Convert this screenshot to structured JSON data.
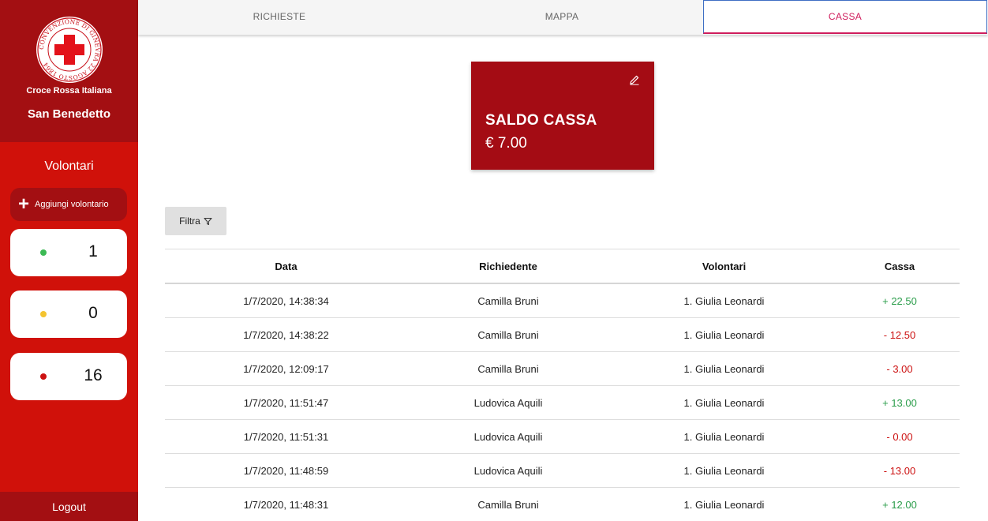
{
  "sidebar": {
    "org_name": "Croce Rossa Italiana",
    "branch_name": "San Benedetto",
    "logo_text": "CONVENZIONE DI GINEVRA 22 AGOSTO 1864",
    "volunteers_title": "Volontari",
    "add_volunteer_label": "Aggiungi volontario",
    "stats": [
      {
        "status": "available",
        "color": "#3cba54",
        "count": "1"
      },
      {
        "status": "busy",
        "color": "#f4c430",
        "count": "0"
      },
      {
        "status": "unavailable",
        "color": "#cc1111",
        "count": "16"
      }
    ],
    "logout_label": "Logout"
  },
  "tabs": [
    {
      "label": "RICHIESTE",
      "active": false
    },
    {
      "label": "MAPPA",
      "active": false
    },
    {
      "label": "CASSA",
      "active": true
    }
  ],
  "balance": {
    "title": "SALDO CASSA",
    "amount": "€ 7.00"
  },
  "filter_label": "Filtra",
  "table": {
    "headers": [
      "Data",
      "Richiedente",
      "Volontari",
      "Cassa"
    ],
    "rows": [
      {
        "date": "1/7/2020, 14:38:34",
        "requester": "Camilla Bruni",
        "volunteers": "1. Giulia Leonardi",
        "amount": "+ 22.50",
        "sign": "pos"
      },
      {
        "date": "1/7/2020, 14:38:22",
        "requester": "Camilla Bruni",
        "volunteers": "1. Giulia Leonardi",
        "amount": "- 12.50",
        "sign": "neg"
      },
      {
        "date": "1/7/2020, 12:09:17",
        "requester": "Camilla Bruni",
        "volunteers": "1. Giulia Leonardi",
        "amount": "- 3.00",
        "sign": "neg"
      },
      {
        "date": "1/7/2020, 11:51:47",
        "requester": "Ludovica Aquili",
        "volunteers": "1. Giulia Leonardi",
        "amount": "+ 13.00",
        "sign": "pos"
      },
      {
        "date": "1/7/2020, 11:51:31",
        "requester": "Ludovica Aquili",
        "volunteers": "1. Giulia Leonardi",
        "amount": "- 0.00",
        "sign": "neg"
      },
      {
        "date": "1/7/2020, 11:48:59",
        "requester": "Ludovica Aquili",
        "volunteers": "1. Giulia Leonardi",
        "amount": "- 13.00",
        "sign": "neg"
      },
      {
        "date": "1/7/2020, 11:48:31",
        "requester": "Camilla Bruni",
        "volunteers": "1. Giulia Leonardi",
        "amount": "+ 12.00",
        "sign": "pos"
      }
    ]
  },
  "colors": {
    "sidebar": "#d0110a",
    "sidebar_dark": "#a30f12",
    "balance_card": "#a40c14",
    "active_tab": "#cf1d5c",
    "positive": "#2a9d4a",
    "negative": "#cc1111"
  }
}
